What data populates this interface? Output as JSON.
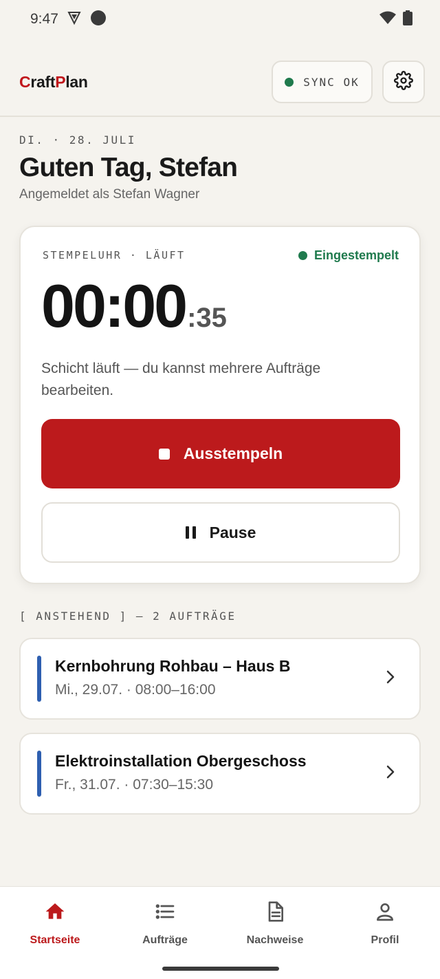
{
  "status_bar": {
    "time": "9:47"
  },
  "header": {
    "brand_first": "C",
    "brand_mid": "raft",
    "brand_p": "P",
    "brand_last": "lan",
    "sync_label": "SYNC OK",
    "accent_color": "#bc1a1c"
  },
  "intro": {
    "date": "DI. · 28. JULI",
    "greeting": "Guten Tag, Stefan",
    "logged_in": "Angemeldet als Stefan Wagner"
  },
  "clock": {
    "heading": "STEMPELUHR · LÄUFT",
    "state": "Eingestempelt",
    "time_main": "00:00",
    "time_seconds": ":35",
    "description": "Schicht läuft — du kannst mehrere Aufträge bearbeiten.",
    "clock_out_label": "Ausstempeln",
    "pause_label": "Pause",
    "state_color": "#1f7a4d"
  },
  "upcoming": {
    "title": "[ ANSTEHEND ] — 2 AUFTRÄGE",
    "jobs": [
      {
        "title": "Kernbohrung Rohbau – Haus B",
        "time": "Mi., 29.07. · 08:00–16:00"
      },
      {
        "title": "Elektroinstallation Obergeschoss",
        "time": "Fr., 31.07. · 07:30–15:30"
      }
    ]
  },
  "nav": {
    "items": [
      {
        "label": "Startseite",
        "icon": "home-icon",
        "active": true
      },
      {
        "label": "Aufträge",
        "icon": "list-icon",
        "active": false
      },
      {
        "label": "Nachweise",
        "icon": "document-icon",
        "active": false
      },
      {
        "label": "Profil",
        "icon": "person-icon",
        "active": false
      }
    ]
  }
}
